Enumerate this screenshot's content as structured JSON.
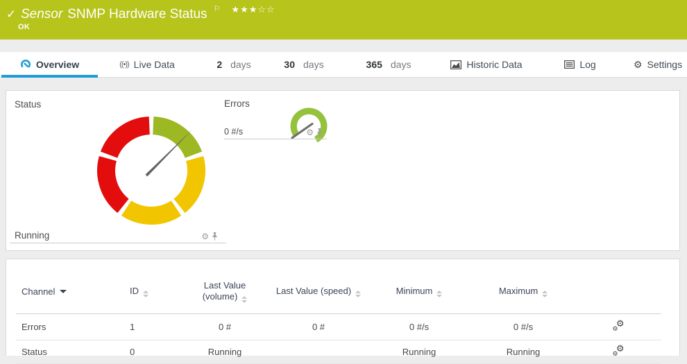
{
  "titlebar": {
    "kind_label": "Sensor",
    "title": "SNMP Hardware Status",
    "status_text": "OK",
    "stars_filled": "★★★",
    "stars_empty": "☆☆",
    "bg_color": "#b7c41b"
  },
  "icons": {
    "check": "✓",
    "flag": "⚐",
    "gear": "⚙",
    "live_data": "((•))"
  },
  "tabs": {
    "overview": {
      "label": "Overview"
    },
    "live_data": {
      "label": "Live Data"
    },
    "days_2": {
      "num": "2",
      "unit": "days"
    },
    "days_30": {
      "num": "30",
      "unit": "days"
    },
    "days_365": {
      "num": "365",
      "unit": "days"
    },
    "historic_data": {
      "label": "Historic Data"
    },
    "log": {
      "label": "Log"
    },
    "settings": {
      "label": "Settings"
    }
  },
  "overview": {
    "status_gauge": {
      "label": "Status",
      "value": "Running",
      "segment_colors": {
        "ok": "#9cb822",
        "warning": "#f1c500",
        "error": "#e30d0d"
      },
      "needle_points_to": "ok"
    },
    "errors_gauge": {
      "label": "Errors",
      "value": "0 #/s",
      "arc_color": "#95c23d"
    }
  },
  "table": {
    "headers": {
      "channel": "Channel",
      "id": "ID",
      "last_value_volume": "Last Value (volume)",
      "last_value_speed": "Last Value (speed)",
      "minimum": "Minimum",
      "maximum": "Maximum"
    },
    "rows": [
      {
        "cells": [
          "Errors",
          "1",
          "0 #",
          "0 #",
          "0 #/s",
          "0 #/s"
        ]
      },
      {
        "cells": [
          "Status",
          "0",
          "Running",
          "",
          "Running",
          "Running"
        ]
      }
    ]
  }
}
